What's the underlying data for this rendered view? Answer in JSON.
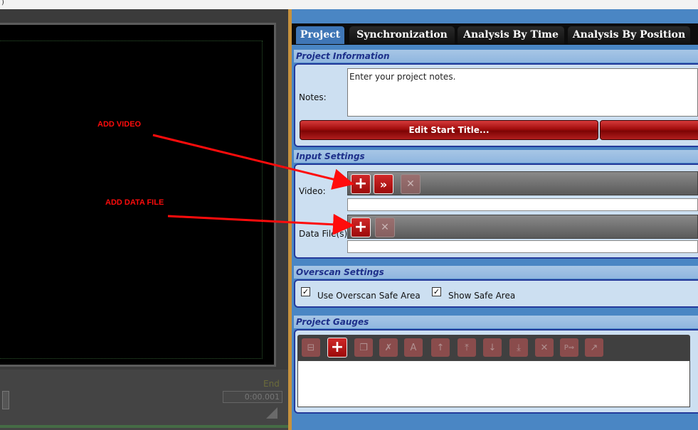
{
  "window": {
    "corner_glyph": ")"
  },
  "left_panel": {
    "end_label": "End",
    "end_value": "0:00.001"
  },
  "tabs": [
    {
      "label": "Project",
      "active": true
    },
    {
      "label": "Synchronization",
      "active": false
    },
    {
      "label": "Analysis By Time",
      "active": false
    },
    {
      "label": "Analysis By Position",
      "active": false
    }
  ],
  "project_information": {
    "header": "Project Information",
    "notes_label": "Notes:",
    "notes_value": "Enter your project notes.",
    "edit_start_title_button": "Edit Start Title..."
  },
  "input_settings": {
    "header": "Input Settings",
    "video_label": "Video:",
    "data_files_label": "Data File(s):"
  },
  "overscan_settings": {
    "header": "Overscan Settings",
    "use_overscan_label": "Use Overscan Safe Area",
    "use_overscan_checked": true,
    "show_safe_area_label": "Show Safe Area",
    "show_safe_area_checked": true
  },
  "project_gauges": {
    "header": "Project Gauges"
  },
  "annotations": {
    "add_video": "ADD VIDEO",
    "add_data_file": "ADD DATA FILE",
    "arrow_color": "#ff0c0c"
  },
  "icons": {
    "add": "plus-icon",
    "forward": "double-chevron-right-icon",
    "remove": "x-icon"
  }
}
